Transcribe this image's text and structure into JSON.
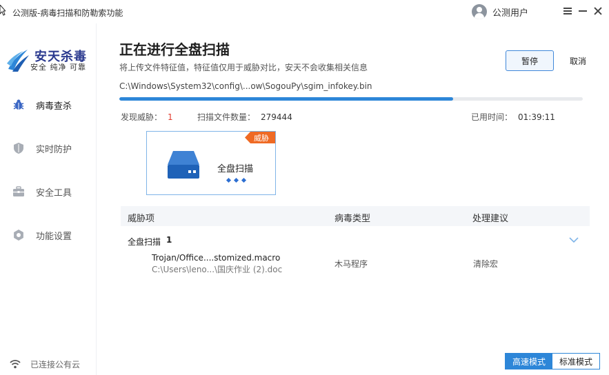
{
  "window": {
    "title": "公测版-病毒扫描和防勒索功能",
    "user_name": "公测用户"
  },
  "sidebar": {
    "logo_title": "安天杀毒",
    "logo_subtitle": "安全 纯净 可靠",
    "items": [
      {
        "label": "病毒查杀",
        "icon": "bug-icon",
        "active": true
      },
      {
        "label": "实时防护",
        "icon": "shield-icon",
        "active": false
      },
      {
        "label": "安全工具",
        "icon": "toolbox-icon",
        "active": false
      },
      {
        "label": "功能设置",
        "icon": "gear-icon",
        "active": false
      }
    ],
    "cloud_status": "已连接公有云"
  },
  "scan": {
    "title": "正在进行全盘扫描",
    "subtitle": "将上传文件特征值，特征值仅用于威胁对比，安天不会收集相关信息",
    "pause_label": "暂停",
    "cancel_label": "取消",
    "current_path": "C:\\Windows\\System32\\config\\...ow\\SogouPy\\sgim_infokey.bin",
    "progress_percent": 72,
    "threats_label": "发现威胁：",
    "threats_value": "1",
    "files_label": "扫描文件数量：",
    "files_value": "279444",
    "elapsed_label": "已用时间：",
    "elapsed_value": "01:39:11"
  },
  "card": {
    "label": "全盘扫描",
    "badge": "威胁"
  },
  "table": {
    "headers": [
      "威胁项",
      "病毒类型",
      "处理建议"
    ],
    "group_label": "全盘扫描",
    "group_count": "1",
    "rows": [
      {
        "name": "Trojan/Office....stomized.macro",
        "path": "C:\\Users\\leno...\\国庆作业 (2).doc",
        "type": "木马程序",
        "advice": "清除宏"
      }
    ]
  },
  "modes": {
    "fast": "高速模式",
    "standard": "标准模式",
    "active": "fast"
  },
  "colors": {
    "accent": "#2d86d8",
    "threat_red": "#e23b2e",
    "badge_orange": "#ef6a24",
    "logo_blue": "#2b3a8f"
  }
}
